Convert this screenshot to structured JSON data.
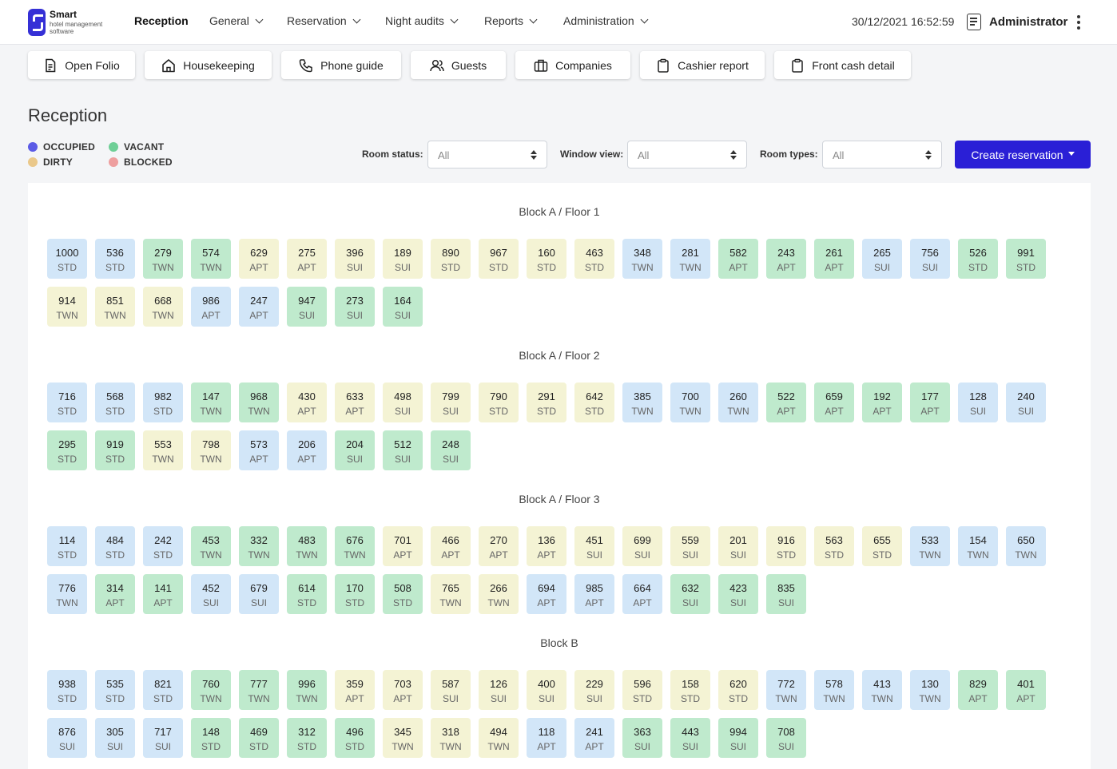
{
  "brand": {
    "name": "Smart",
    "subtitle": "hotel management software"
  },
  "nav": [
    {
      "label": "Reception",
      "active": true,
      "dropdown": false
    },
    {
      "label": "General",
      "active": false,
      "dropdown": true
    },
    {
      "label": "Reservation",
      "active": false,
      "dropdown": true
    },
    {
      "label": "Night audits",
      "active": false,
      "dropdown": true
    },
    {
      "label": "Reports",
      "active": false,
      "dropdown": true
    },
    {
      "label": "Administration",
      "active": false,
      "dropdown": true
    }
  ],
  "datetime": "30/12/2021 16:52:59",
  "user": {
    "name": "Administrator"
  },
  "quick_actions": [
    {
      "label": "Open Folio",
      "icon": "document-icon"
    },
    {
      "label": "Housekeeping",
      "icon": "house-icon"
    },
    {
      "label": "Phone guide",
      "icon": "phone-icon"
    },
    {
      "label": "Guests",
      "icon": "users-icon"
    },
    {
      "label": "Companies",
      "icon": "briefcase-icon"
    },
    {
      "label": "Cashier report",
      "icon": "clipboard-icon"
    },
    {
      "label": "Front cash detail",
      "icon": "clipboard-icon"
    }
  ],
  "page_title": "Reception",
  "legend": [
    {
      "label": "OCCUPIED",
      "color": "#5b5be6"
    },
    {
      "label": "VACANT",
      "color": "#6fcf97"
    },
    {
      "label": "DIRTY",
      "color": "#eac88a"
    },
    {
      "label": "BLOCKED",
      "color": "#ee9f9f"
    }
  ],
  "filters": [
    {
      "label": "Room status:",
      "value": "All"
    },
    {
      "label": "Window view:",
      "value": "All"
    },
    {
      "label": "Room types:",
      "value": "All"
    }
  ],
  "create_button": "Create reservation",
  "status_colors": {
    "occupied": "#d2e6f8",
    "vacant": "#bfeacd",
    "dirty": "#f4f3d4",
    "blocked": "#f5d8d8"
  },
  "blocks": [
    {
      "title": "Block A / Floor 1",
      "rooms": [
        [
          "1000",
          "STD",
          "occupied"
        ],
        [
          "536",
          "STD",
          "occupied"
        ],
        [
          "279",
          "TWN",
          "vacant"
        ],
        [
          "574",
          "TWN",
          "vacant"
        ],
        [
          "629",
          "APT",
          "dirty"
        ],
        [
          "275",
          "APT",
          "dirty"
        ],
        [
          "396",
          "SUI",
          "dirty"
        ],
        [
          "189",
          "SUI",
          "dirty"
        ],
        [
          "890",
          "STD",
          "dirty"
        ],
        [
          "967",
          "STD",
          "dirty"
        ],
        [
          "160",
          "STD",
          "dirty"
        ],
        [
          "463",
          "STD",
          "dirty"
        ],
        [
          "348",
          "TWN",
          "occupied"
        ],
        [
          "281",
          "TWN",
          "occupied"
        ],
        [
          "582",
          "APT",
          "vacant"
        ],
        [
          "243",
          "APT",
          "vacant"
        ],
        [
          "261",
          "APT",
          "vacant"
        ],
        [
          "265",
          "SUI",
          "occupied"
        ],
        [
          "756",
          "SUI",
          "occupied"
        ],
        [
          "526",
          "STD",
          "vacant"
        ],
        [
          "991",
          "STD",
          "vacant"
        ],
        [
          "914",
          "TWN",
          "dirty"
        ],
        [
          "851",
          "TWN",
          "dirty"
        ],
        [
          "668",
          "TWN",
          "dirty"
        ],
        [
          "986",
          "APT",
          "occupied"
        ],
        [
          "247",
          "APT",
          "occupied"
        ],
        [
          "947",
          "SUI",
          "vacant"
        ],
        [
          "273",
          "SUI",
          "vacant"
        ],
        [
          "164",
          "SUI",
          "vacant"
        ]
      ]
    },
    {
      "title": "Block A / Floor 2",
      "rooms": [
        [
          "716",
          "STD",
          "occupied"
        ],
        [
          "568",
          "STD",
          "occupied"
        ],
        [
          "982",
          "STD",
          "occupied"
        ],
        [
          "147",
          "TWN",
          "vacant"
        ],
        [
          "968",
          "TWN",
          "vacant"
        ],
        [
          "430",
          "APT",
          "dirty"
        ],
        [
          "633",
          "APT",
          "dirty"
        ],
        [
          "498",
          "SUI",
          "dirty"
        ],
        [
          "799",
          "SUI",
          "dirty"
        ],
        [
          "790",
          "STD",
          "dirty"
        ],
        [
          "291",
          "STD",
          "dirty"
        ],
        [
          "642",
          "STD",
          "dirty"
        ],
        [
          "385",
          "TWN",
          "occupied"
        ],
        [
          "700",
          "TWN",
          "occupied"
        ],
        [
          "260",
          "TWN",
          "occupied"
        ],
        [
          "522",
          "APT",
          "vacant"
        ],
        [
          "659",
          "APT",
          "vacant"
        ],
        [
          "192",
          "APT",
          "vacant"
        ],
        [
          "177",
          "APT",
          "vacant"
        ],
        [
          "128",
          "SUI",
          "occupied"
        ],
        [
          "240",
          "SUI",
          "occupied"
        ],
        [
          "295",
          "STD",
          "vacant"
        ],
        [
          "919",
          "STD",
          "vacant"
        ],
        [
          "553",
          "TWN",
          "dirty"
        ],
        [
          "798",
          "TWN",
          "dirty"
        ],
        [
          "573",
          "APT",
          "occupied"
        ],
        [
          "206",
          "APT",
          "occupied"
        ],
        [
          "204",
          "SUI",
          "vacant"
        ],
        [
          "512",
          "SUI",
          "vacant"
        ],
        [
          "248",
          "SUI",
          "vacant"
        ]
      ]
    },
    {
      "title": "Block A / Floor 3",
      "rooms": [
        [
          "114",
          "STD",
          "occupied"
        ],
        [
          "484",
          "STD",
          "occupied"
        ],
        [
          "242",
          "STD",
          "occupied"
        ],
        [
          "453",
          "TWN",
          "vacant"
        ],
        [
          "332",
          "TWN",
          "vacant"
        ],
        [
          "483",
          "TWN",
          "vacant"
        ],
        [
          "676",
          "TWN",
          "vacant"
        ],
        [
          "701",
          "APT",
          "dirty"
        ],
        [
          "466",
          "APT",
          "dirty"
        ],
        [
          "270",
          "APT",
          "dirty"
        ],
        [
          "136",
          "APT",
          "dirty"
        ],
        [
          "451",
          "SUI",
          "dirty"
        ],
        [
          "699",
          "SUI",
          "dirty"
        ],
        [
          "559",
          "SUI",
          "dirty"
        ],
        [
          "201",
          "SUI",
          "dirty"
        ],
        [
          "916",
          "STD",
          "dirty"
        ],
        [
          "563",
          "STD",
          "dirty"
        ],
        [
          "655",
          "STD",
          "dirty"
        ],
        [
          "533",
          "TWN",
          "occupied"
        ],
        [
          "154",
          "TWN",
          "occupied"
        ],
        [
          "650",
          "TWN",
          "occupied"
        ],
        [
          "776",
          "TWN",
          "occupied"
        ],
        [
          "314",
          "APT",
          "vacant"
        ],
        [
          "141",
          "APT",
          "vacant"
        ],
        [
          "452",
          "SUI",
          "occupied"
        ],
        [
          "679",
          "SUI",
          "occupied"
        ],
        [
          "614",
          "STD",
          "vacant"
        ],
        [
          "170",
          "STD",
          "vacant"
        ],
        [
          "508",
          "STD",
          "vacant"
        ],
        [
          "765",
          "TWN",
          "dirty"
        ],
        [
          "266",
          "TWN",
          "dirty"
        ],
        [
          "694",
          "APT",
          "occupied"
        ],
        [
          "985",
          "APT",
          "occupied"
        ],
        [
          "664",
          "APT",
          "occupied"
        ],
        [
          "632",
          "SUI",
          "vacant"
        ],
        [
          "423",
          "SUI",
          "vacant"
        ],
        [
          "835",
          "SUI",
          "vacant"
        ]
      ]
    },
    {
      "title": "Block B",
      "rooms": [
        [
          "938",
          "STD",
          "occupied"
        ],
        [
          "535",
          "STD",
          "occupied"
        ],
        [
          "821",
          "STD",
          "occupied"
        ],
        [
          "760",
          "TWN",
          "vacant"
        ],
        [
          "777",
          "TWN",
          "vacant"
        ],
        [
          "996",
          "TWN",
          "vacant"
        ],
        [
          "359",
          "APT",
          "dirty"
        ],
        [
          "703",
          "APT",
          "dirty"
        ],
        [
          "587",
          "SUI",
          "dirty"
        ],
        [
          "126",
          "SUI",
          "dirty"
        ],
        [
          "400",
          "SUI",
          "dirty"
        ],
        [
          "229",
          "SUI",
          "dirty"
        ],
        [
          "596",
          "STD",
          "dirty"
        ],
        [
          "158",
          "STD",
          "dirty"
        ],
        [
          "620",
          "STD",
          "dirty"
        ],
        [
          "772",
          "TWN",
          "occupied"
        ],
        [
          "578",
          "TWN",
          "occupied"
        ],
        [
          "413",
          "TWN",
          "occupied"
        ],
        [
          "130",
          "TWN",
          "occupied"
        ],
        [
          "829",
          "APT",
          "vacant"
        ],
        [
          "401",
          "APT",
          "vacant"
        ],
        [
          "876",
          "SUI",
          "occupied"
        ],
        [
          "305",
          "SUI",
          "occupied"
        ],
        [
          "717",
          "SUI",
          "occupied"
        ],
        [
          "148",
          "STD",
          "vacant"
        ],
        [
          "469",
          "STD",
          "vacant"
        ],
        [
          "312",
          "STD",
          "vacant"
        ],
        [
          "496",
          "STD",
          "vacant"
        ],
        [
          "345",
          "TWN",
          "dirty"
        ],
        [
          "318",
          "TWN",
          "dirty"
        ],
        [
          "494",
          "TWN",
          "dirty"
        ],
        [
          "118",
          "APT",
          "occupied"
        ],
        [
          "241",
          "APT",
          "occupied"
        ],
        [
          "363",
          "SUI",
          "vacant"
        ],
        [
          "443",
          "SUI",
          "vacant"
        ],
        [
          "994",
          "SUI",
          "vacant"
        ],
        [
          "708",
          "SUI",
          "vacant"
        ]
      ]
    }
  ]
}
